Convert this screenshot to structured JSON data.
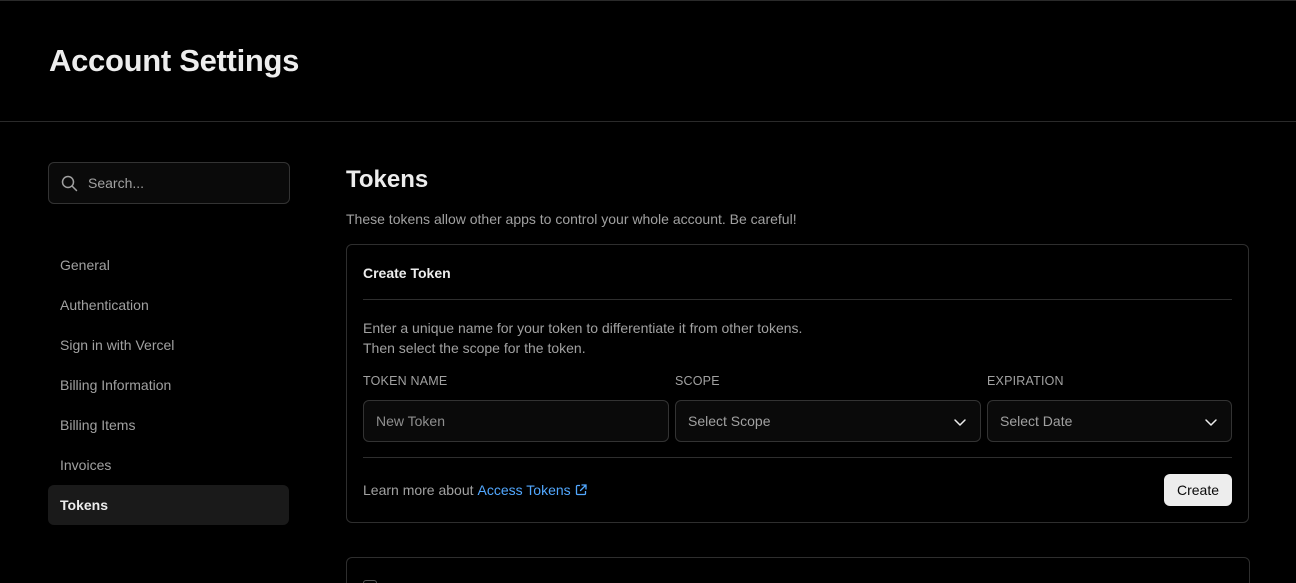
{
  "header": {
    "title": "Account Settings"
  },
  "sidebar": {
    "search": {
      "placeholder": "Search..."
    },
    "items": [
      {
        "label": "General"
      },
      {
        "label": "Authentication"
      },
      {
        "label": "Sign in with Vercel"
      },
      {
        "label": "Billing Information"
      },
      {
        "label": "Billing Items"
      },
      {
        "label": "Invoices"
      },
      {
        "label": "Tokens",
        "active": true
      }
    ]
  },
  "main": {
    "title": "Tokens",
    "description": "These tokens allow other apps to control your whole account. Be careful!",
    "create_card": {
      "title": "Create Token",
      "help_line1": "Enter a unique name for your token to differentiate it from other tokens.",
      "help_line2": "Then select the scope for the token.",
      "token_name_label": "TOKEN NAME",
      "token_name_placeholder": "New Token",
      "scope_label": "SCOPE",
      "scope_value": "Select Scope",
      "expiration_label": "EXPIRATION",
      "expiration_value": "Select Date",
      "learn_prefix": "Learn more about",
      "learn_link": "Access Tokens",
      "create_label": "Create"
    }
  },
  "icons": {
    "search": "search-icon",
    "chevron": "chevron-down-icon",
    "external": "external-link-icon"
  },
  "colors": {
    "background": "#000000",
    "link": "#52a8ff",
    "button": "#ededed"
  }
}
